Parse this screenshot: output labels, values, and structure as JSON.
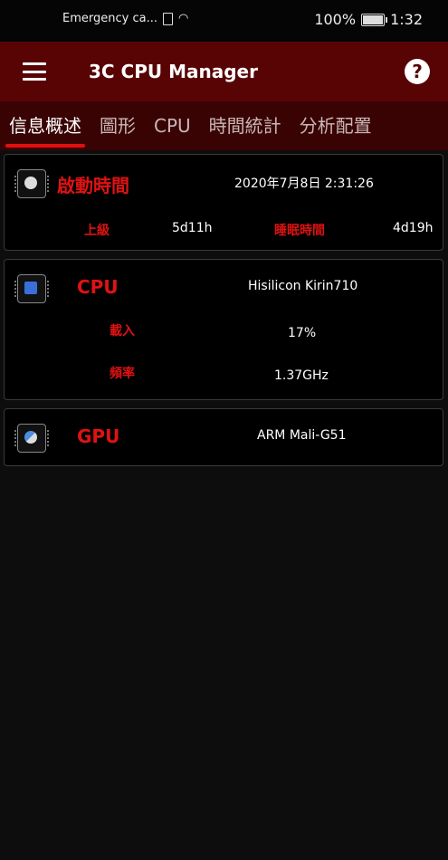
{
  "status_bar": {
    "carrier": "Emergency ca...",
    "battery": "100%",
    "time": "1:32"
  },
  "app": {
    "title": "3C CPU Manager",
    "help": "?"
  },
  "tabs": [
    {
      "label": "信息概述",
      "active": true
    },
    {
      "label": "圖形",
      "active": false
    },
    {
      "label": "CPU",
      "active": false
    },
    {
      "label": "時間統計",
      "active": false
    },
    {
      "label": "分析配置",
      "active": false
    }
  ],
  "uptime_card": {
    "title": "啟動時間",
    "boot_datetime": "2020年7月8日 2:31:26",
    "uptime_label": "上級",
    "uptime_value": "5d11h",
    "sleep_label": "睡眠時間",
    "sleep_value": "4d19h"
  },
  "cpu_card": {
    "title": "CPU",
    "model": "Hisilicon Kirin710",
    "load_label": "載入",
    "load_value": "17%",
    "freq_label": "頻率",
    "freq_value": "1.37GHz"
  },
  "gpu_card": {
    "title": "GPU",
    "model": "ARM Mali-G51"
  },
  "colors": {
    "appbar": "#580404",
    "tabbar": "#3a0303",
    "accent_red": "#e01212"
  }
}
